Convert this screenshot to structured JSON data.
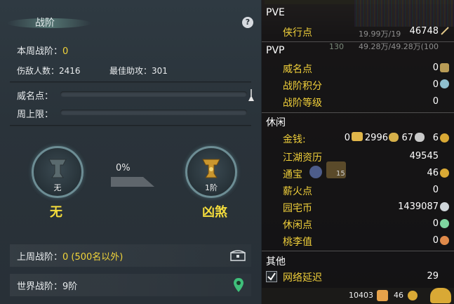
{
  "left_panel": {
    "title": "战阶",
    "help": "?",
    "weekly_rank_label": "本周战阶：",
    "weekly_rank_value": "0",
    "kills_label": "伤敌人数：",
    "kills_value": "2416",
    "best_assist_label": "最佳助攻：",
    "best_assist_value": "301",
    "prestige_label": "威名点：",
    "prestige_progress": 0,
    "weekly_cap_label": "周上限：",
    "weekly_cap_progress": 0,
    "current_rank": {
      "badge": "无",
      "name": "无"
    },
    "progress_percent": "0%",
    "next_rank": {
      "badge": "1阶",
      "name": "凶煞"
    },
    "last_week_label": "上周战阶：",
    "last_week_value": "0 (500名以外)",
    "world_rank_label": "世界战阶：",
    "world_rank_value": "9阶"
  },
  "right_panel": {
    "pve": {
      "title": "PVE",
      "items": [
        {
          "label": "侠行点",
          "value": "46748"
        }
      ]
    },
    "pvp": {
      "title": "PVP",
      "items": [
        {
          "label": "威名点",
          "value": "0"
        },
        {
          "label": "战阶积分",
          "value": "0"
        },
        {
          "label": "战阶等级",
          "value": "0"
        }
      ]
    },
    "leisure": {
      "title": "休闲",
      "money_label": "金钱:",
      "money_values": [
        "0",
        "2996",
        "67",
        "6"
      ],
      "items": [
        {
          "label": "江湖资历",
          "value": "49545"
        },
        {
          "label": "通宝",
          "value": "46",
          "extra": "15"
        },
        {
          "label": "薪火点",
          "value": "0"
        },
        {
          "label": "园宅币",
          "value": "1439087"
        },
        {
          "label": "休闲点",
          "value": "0"
        },
        {
          "label": "桃李值",
          "value": "0"
        }
      ]
    },
    "other": {
      "title": "其他",
      "items": [
        {
          "label": "网络延迟",
          "value": "29",
          "checked": true
        }
      ]
    },
    "bg_text": [
      "19.99万/19",
      "49.28万/49.28万(100",
      "130"
    ]
  },
  "bottom_bar": {
    "value1": "10403",
    "value2": "46"
  },
  "colors": {
    "accent_yellow": "#f2d53a",
    "label_gold": "#f0cf3a",
    "panel_bg": "#2b343b"
  }
}
